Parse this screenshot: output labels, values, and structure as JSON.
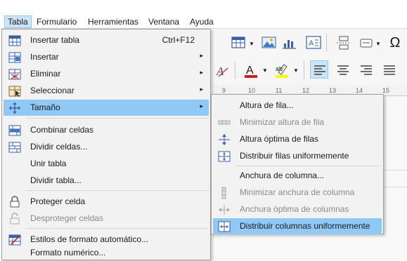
{
  "menubar": {
    "items": [
      "Tabla",
      "Formulario",
      "Herramientas",
      "Ventana",
      "Ayuda"
    ]
  },
  "ruler": {
    "ticks": [
      "9",
      "10",
      "11",
      "12",
      "13",
      "14",
      "15"
    ]
  },
  "table_menu": {
    "items": [
      {
        "label": "Insertar tabla",
        "shortcut": "Ctrl+F12",
        "icon": "insert-table-icon"
      },
      {
        "label": "Insertar",
        "submenu": true,
        "icon": "insert-icon"
      },
      {
        "label": "Eliminar",
        "submenu": true,
        "icon": "delete-icon"
      },
      {
        "label": "Seleccionar",
        "submenu": true,
        "icon": "select-icon"
      },
      {
        "label": "Tamaño",
        "submenu": true,
        "icon": "size-icon",
        "highlighted": true
      },
      {
        "label": "Combinar celdas",
        "icon": "merge-cells-icon"
      },
      {
        "label": "Dividir celdas...",
        "icon": "split-cells-icon"
      },
      {
        "label": "Unir tabla"
      },
      {
        "label": "Dividir tabla..."
      },
      {
        "label": "Proteger celda",
        "icon": "lock-icon"
      },
      {
        "label": "Desproteger celdas",
        "icon": "unlock-icon",
        "disabled": true
      },
      {
        "label": "Estilos de formato automático...",
        "icon": "autoformat-icon"
      },
      {
        "label": "Formato numérico..."
      }
    ]
  },
  "size_submenu": {
    "items": [
      {
        "label": "Altura de fila..."
      },
      {
        "label": "Minimizar altura de fila",
        "icon": "minimize-row-height-icon",
        "disabled": true
      },
      {
        "label": "Altura óptima de filas",
        "icon": "optimal-row-height-icon"
      },
      {
        "label": "Distribuir filas uniformemente",
        "icon": "distribute-rows-icon"
      },
      {
        "label": "Anchura de columna..."
      },
      {
        "label": "Minimizar anchura de columna",
        "icon": "minimize-column-width-icon",
        "disabled": true
      },
      {
        "label": "Anchura óptima de columnas",
        "icon": "optimal-column-width-icon",
        "disabled": true
      },
      {
        "label": "Distribuir columnas uniformemente",
        "icon": "distribute-columns-icon",
        "highlighted": true
      }
    ]
  },
  "colors": {
    "highlight": "#90c8f6",
    "menu_bg": "#f2f2f2",
    "font_color_red": "#c9211e",
    "highlight_yellow": "#ffff00"
  }
}
